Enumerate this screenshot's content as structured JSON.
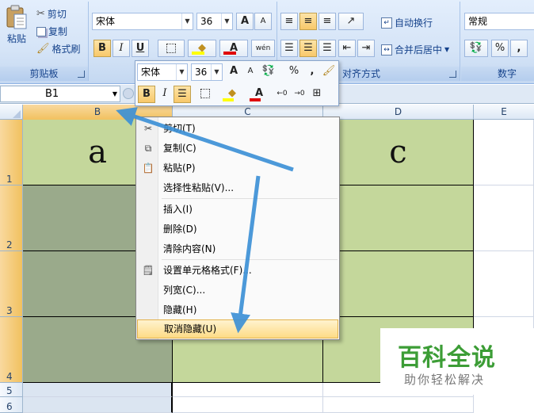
{
  "ribbon": {
    "clipboard": {
      "paste": "粘贴",
      "cut": "剪切",
      "copy": "复制",
      "format_painter": "格式刷",
      "label": "剪贴板"
    },
    "font": {
      "name": "宋体",
      "size": "36",
      "bold": "B",
      "italic": "I",
      "underline": "U",
      "grow": "A",
      "shrink": "A",
      "wen": "wén",
      "color": "A"
    },
    "alignment": {
      "wrap": "自动换行",
      "merge": "合并后居中",
      "label": "对齐方式"
    },
    "number": {
      "format": "常规",
      "percent": "%",
      "comma": ",",
      "label": "数字"
    }
  },
  "formula_bar": {
    "name_box": "B1"
  },
  "grid": {
    "columns": [
      "B",
      "C",
      "D",
      "E"
    ],
    "rows": [
      "1",
      "2",
      "3",
      "4",
      "5",
      "6"
    ],
    "cells": {
      "b1": "a",
      "d1": "c"
    }
  },
  "mini_toolbar": {
    "font": "宋体",
    "size": "36",
    "grow": "A",
    "shrink": "A",
    "percent": "%",
    "comma": ",",
    "bold": "B",
    "italic": "I",
    "color": "A"
  },
  "context_menu": {
    "items": [
      "剪切(T)",
      "复制(C)",
      "粘贴(P)",
      "选择性粘贴(V)...",
      "插入(I)",
      "删除(D)",
      "清除内容(N)",
      "设置单元格格式(F)...",
      "列宽(C)...",
      "隐藏(H)",
      "取消隐藏(U)"
    ]
  },
  "watermark": {
    "title": "百科全说",
    "subtitle": "助你轻松解决"
  },
  "colors": {
    "header_selected": "#f1c15f",
    "cell_green": "#c4d79b",
    "cell_gray": "#9aaa8b",
    "arrow": "#3a8fd6",
    "menu_highlight": "#fddb86"
  }
}
